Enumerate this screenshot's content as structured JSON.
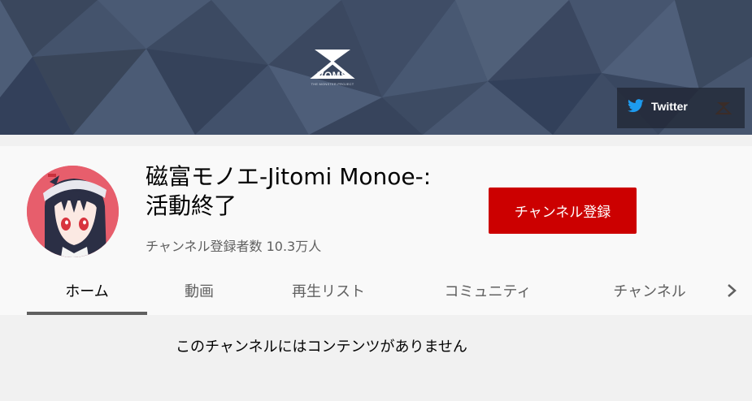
{
  "banner": {
    "logo_text": "VOMS",
    "logo_subtext": "THE MONSTER PROJECT",
    "links": [
      {
        "label": "Twitter",
        "icon": "twitter-bird-icon"
      },
      {
        "icon": "voms-logo-icon"
      }
    ]
  },
  "channel": {
    "name": "磁富モノエ-Jitomi Monoe-:\n活動終了",
    "subscribers": "チャンネル登録者数 10.3万人",
    "subscribe_label": "チャンネル登録"
  },
  "tabs": [
    {
      "label": "ホーム",
      "active": true
    },
    {
      "label": "動画",
      "active": false
    },
    {
      "label": "再生リスト",
      "active": false
    },
    {
      "label": "コミュニティ",
      "active": false
    },
    {
      "label": "チャンネル",
      "active": false
    }
  ],
  "content": {
    "empty_message": "このチャンネルにはコンテンツがありません"
  },
  "colors": {
    "subscribe_button": "#cc0000",
    "banner_bg": "#41506a",
    "tab_indicator": "#606060"
  }
}
